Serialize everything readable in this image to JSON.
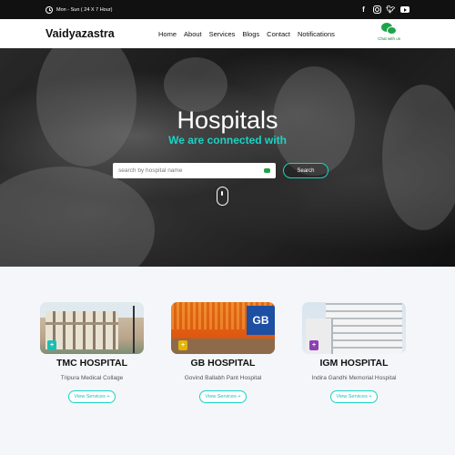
{
  "topbar": {
    "hours": "Mon - Sun ( 24 X 7 Hour)",
    "icons": [
      "clock-icon",
      "facebook-icon",
      "instagram-icon",
      "twitter-icon",
      "youtube-icon"
    ]
  },
  "nav": {
    "brand": "Vaidyazastra",
    "items": [
      "Home",
      "About",
      "Services",
      "Blogs",
      "Contact",
      "Notifications"
    ],
    "chat_label": "Chat with us"
  },
  "hero": {
    "title": "Hospitals",
    "subtitle": "We are connected with",
    "search_placeholder": "search by hospital name",
    "search_button": "Search"
  },
  "hospitals": [
    {
      "name": "TMC HOSPITAL",
      "full_name": "Tripura Medical Collage",
      "button": "View Services +"
    },
    {
      "name": "GB HOSPITAL",
      "full_name": "Govind Ballabh Pant Hospital",
      "button": "View Services +",
      "sign_text": "GB"
    },
    {
      "name": "IGM HOSPITAL",
      "full_name": "Indira Gandhi Memorial Hospital",
      "button": "View Services +"
    }
  ],
  "colors": {
    "accent": "#19d3c5",
    "chat_green": "#1fa34a",
    "topbar": "#111111"
  }
}
